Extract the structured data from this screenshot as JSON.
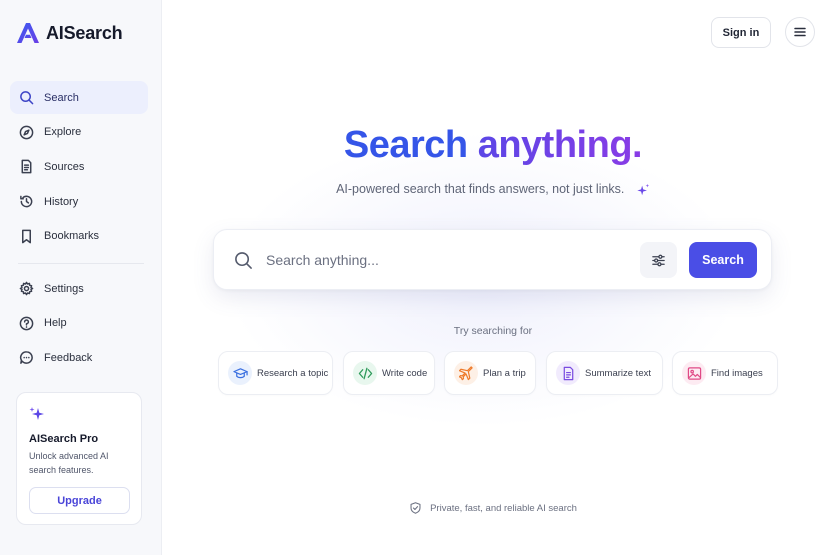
{
  "app": {
    "name": "AISearch"
  },
  "sidebar": {
    "items": [
      {
        "label": "Search",
        "icon": "search-icon",
        "active": true
      },
      {
        "label": "Explore",
        "icon": "compass-icon"
      },
      {
        "label": "Sources",
        "icon": "document-icon"
      },
      {
        "label": "History",
        "icon": "history-icon"
      },
      {
        "label": "Bookmarks",
        "icon": "bookmark-icon"
      },
      {
        "label": "Settings",
        "icon": "gear-icon"
      },
      {
        "label": "Help",
        "icon": "help-icon"
      },
      {
        "label": "Feedback",
        "icon": "chat-icon"
      }
    ],
    "pro_card": {
      "title": "AISearch Pro",
      "description": "Unlock advanced AI search features.",
      "button_label": "Upgrade"
    }
  },
  "header": {
    "signin_label": "Sign in",
    "menu_icon": "hamburger-icon"
  },
  "hero": {
    "title_part1": "Search",
    "title_part2": "anything.",
    "subtitle": "AI-powered search that finds answers, not just links."
  },
  "search": {
    "placeholder": "Search anything...",
    "value": "",
    "button_label": "Search",
    "filter_icon": "sliders-icon"
  },
  "suggestions": {
    "label": "Try searching for",
    "chips": [
      {
        "label": "Research a topic",
        "icon": "graduation-cap-icon"
      },
      {
        "label": "Write code",
        "icon": "code-icon"
      },
      {
        "label": "Plan a trip",
        "icon": "airplane-icon"
      },
      {
        "label": "Summarize text",
        "icon": "document-icon"
      },
      {
        "label": "Find images",
        "icon": "image-icon"
      }
    ]
  },
  "footer": {
    "note": "Private, fast, and reliable AI search"
  },
  "colors": {
    "accent": "#4a4ee6",
    "title_blue": "#3555e8",
    "title_purple": "#8a3ce6",
    "sidebar_active_bg": "#eceffd"
  }
}
